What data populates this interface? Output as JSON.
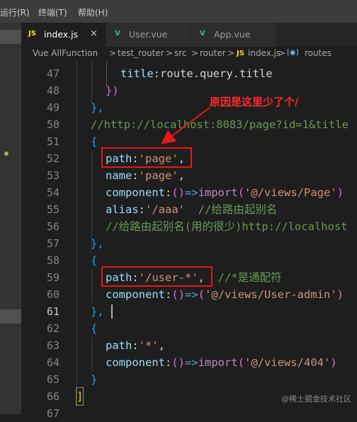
{
  "menu": {
    "items": [
      "运行(R)",
      "终端(T)",
      "帮助(H)"
    ]
  },
  "tabs": [
    {
      "icon": "JS",
      "label": "index.js",
      "active": true,
      "close": "×"
    },
    {
      "icon": "V",
      "label": "User.vue",
      "active": false
    },
    {
      "icon": "V",
      "label": "App.vue",
      "active": false
    }
  ],
  "breadcrumb": [
    "Vue AllFunction",
    "test_router",
    "src",
    "router",
    "index.js",
    "routes"
  ],
  "breadcrumb_js_icon": "JS",
  "breadcrumb_routes_icon": "[◉]",
  "separator": ">",
  "line_numbers": [
    "47",
    "48",
    "49",
    "50",
    "51",
    "52",
    "53",
    "54",
    "55",
    "56",
    "57",
    "58",
    "59",
    "60",
    "61",
    "62",
    "63",
    "64",
    "65",
    "66",
    "67"
  ],
  "current_line": "61",
  "code": {
    "l47_key": "title",
    "l47_rest": ":route.query.title",
    "l48": "})",
    "l49": "},",
    "l50": "//http://localhost:8083/page?id=1&title",
    "l51": "{",
    "l52_key": "path",
    "l52_val": "'page'",
    "l53_key": "name",
    "l53_val": "'page'",
    "l54_key": "component",
    "l54_import": "import",
    "l54_val": "'@/views/Page'",
    "l55_key": "alias",
    "l55_val": "'/aaa'",
    "l55_comment": "//给路由起别名",
    "l56": "//给路由起别名(用的很少)http://localhost",
    "l57": "},",
    "l58": "{",
    "l59_key": "path",
    "l59_val": "'/user-*'",
    "l59_comment": "//*是通配符",
    "l60_key": "component",
    "l60_val": "'@/views/User-admin'",
    "l61": "},",
    "l62": "{",
    "l63_key": "path",
    "l63_val": "'*'",
    "l64_key": "component",
    "l64_import": "import",
    "l64_val": "'@/views/404'",
    "l65": "}",
    "l66": "]"
  },
  "annotation": "原因是这里少了个/",
  "watermark": "@稀土掘金技术社区",
  "colors": {
    "annotation": "#e5191a",
    "js_icon": "#f1dd35",
    "vue_icon": "#41b883"
  }
}
